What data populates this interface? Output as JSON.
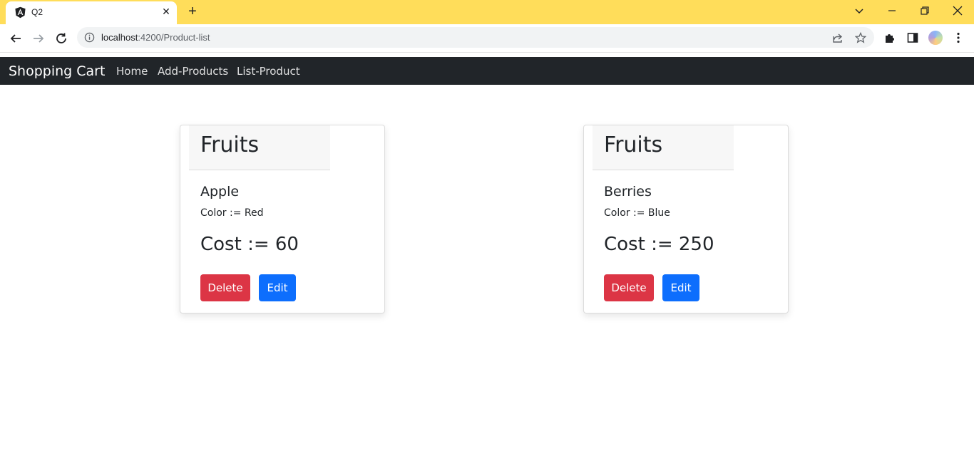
{
  "browser": {
    "tab_title": "Q2",
    "url_host": "localhost",
    "url_path": ":4200/Product-list"
  },
  "navbar": {
    "brand": "Shopping Cart",
    "links": [
      "Home",
      "Add-Products",
      "List-Product"
    ]
  },
  "products": [
    {
      "category": "Fruits",
      "name": "Apple",
      "color": "Color := Red",
      "cost": "Cost := 60",
      "delete_label": "Delete",
      "edit_label": "Edit"
    },
    {
      "category": "Fruits",
      "name": "Berries",
      "color": "Color := Blue",
      "cost": "Cost := 250",
      "delete_label": "Delete",
      "edit_label": "Edit"
    }
  ],
  "colors": {
    "tabstrip": "#ffdd5a",
    "navbar": "#212529",
    "danger": "#dc3545",
    "primary": "#0d6efd"
  }
}
